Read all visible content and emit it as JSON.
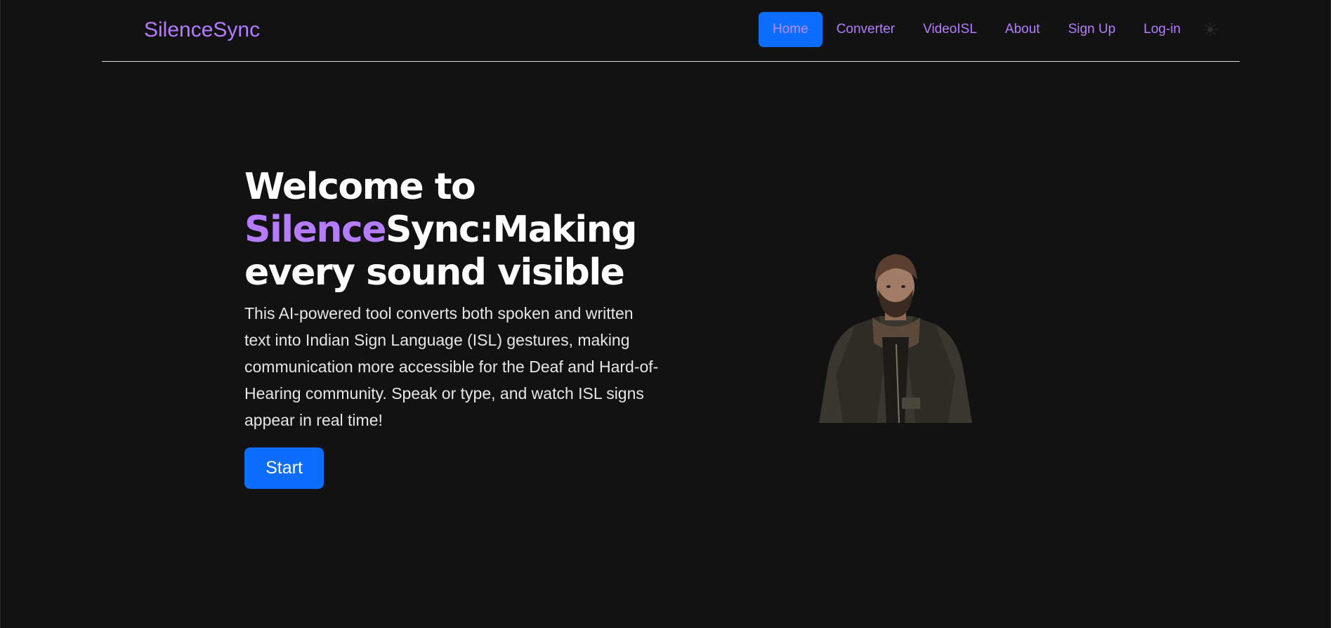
{
  "navbar": {
    "brand": "SilenceSync",
    "links": [
      {
        "label": "Home",
        "active": true
      },
      {
        "label": "Converter"
      },
      {
        "label": "VideoISL"
      },
      {
        "label": "About"
      },
      {
        "label": "Sign Up"
      },
      {
        "label": "Log-in"
      }
    ],
    "theme_icon": "sun-icon"
  },
  "hero": {
    "headline": {
      "line1": "Welcome to",
      "accent": "Silence",
      "line2_rest": "Sync:Making",
      "line3": "every sound visible"
    },
    "description": "This AI-powered tool converts both spoken and written text into Indian Sign Language (ISL) gestures, making communication more accessible for the Deaf and Hard-of-Hearing community. Speak or type, and watch ISL signs appear in real time!",
    "start_label": "Start"
  },
  "colors": {
    "background": "#121212",
    "accent_purple": "#b57cff",
    "primary_blue": "#0d6efd",
    "text_white": "#ffffff"
  }
}
